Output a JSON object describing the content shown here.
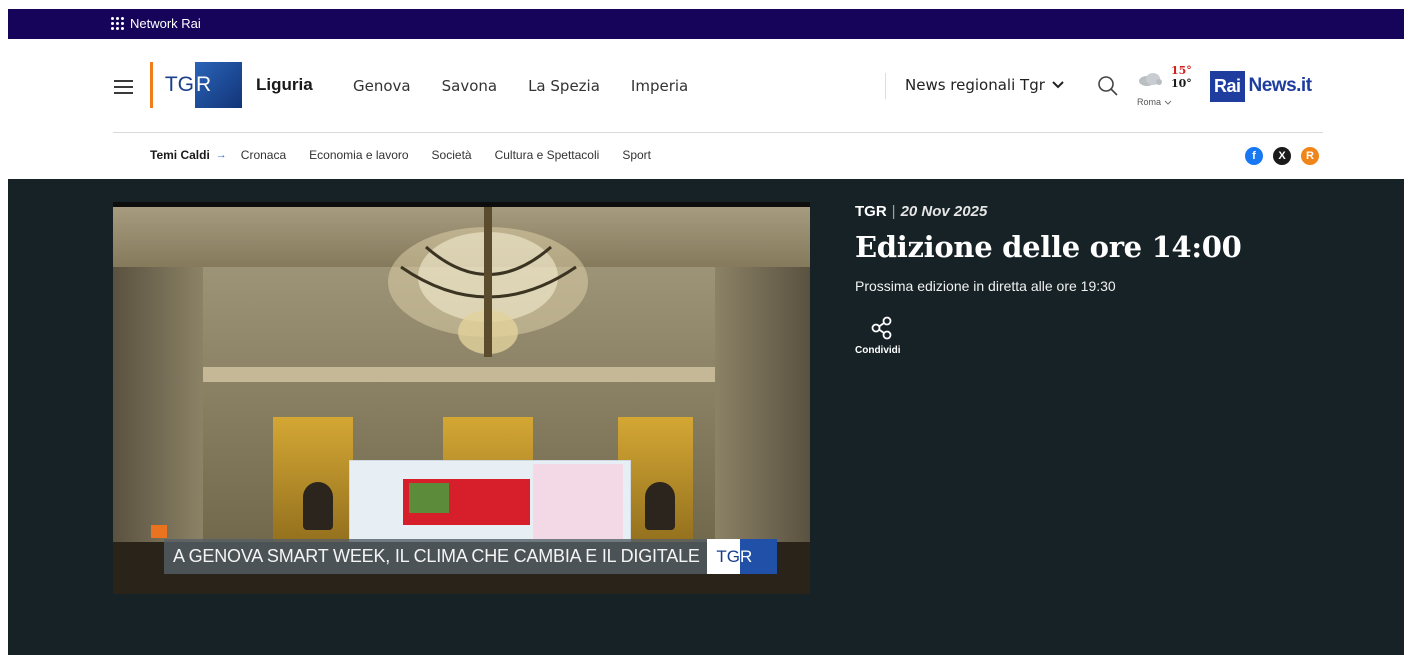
{
  "network_bar": {
    "label": "Network Rai"
  },
  "header": {
    "logo_text": "TGR",
    "region": "Liguria",
    "cities": [
      "Genova",
      "Savona",
      "La Spezia",
      "Imperia"
    ],
    "news_dropdown": "News regionali Tgr",
    "weather": {
      "max": "15°",
      "min": "10°",
      "city": "Roma"
    },
    "rainews": {
      "rai": "Rai",
      "site": "News.it"
    }
  },
  "subnav": {
    "lead": "Temi Caldi",
    "items": [
      "Cronaca",
      "Economia e lavoro",
      "Società",
      "Cultura e Spettacoli",
      "Sport"
    ]
  },
  "social": {
    "facebook": "f",
    "x": "X",
    "rss": "R"
  },
  "video": {
    "ticker": "A GENOVA SMART WEEK, IL CLIMA CHE CAMBIA E IL DIGITALE",
    "logo_text": "TGR"
  },
  "edition": {
    "source": "TGR",
    "separator": "|",
    "date": "20 Nov 2025",
    "title": "Edizione delle ore 14:00",
    "next": "Prossima edizione in diretta alle ore 19:30",
    "share_label": "Condividi"
  },
  "colors": {
    "network_bar": "#15045a",
    "dark_bg": "#172226",
    "rai_blue": "#1f3d9e",
    "tgr_orange": "#f07d1a",
    "temp_max": "#d3201e"
  }
}
